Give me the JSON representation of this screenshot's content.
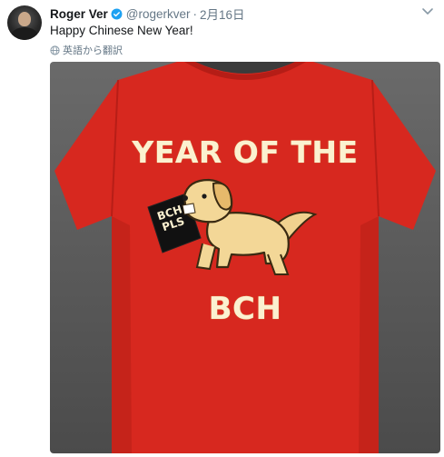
{
  "tweet": {
    "display_name": "Roger Ver",
    "handle": "@rogerkver",
    "separator": "·",
    "timestamp": "2月16日",
    "text": "Happy Chinese New Year!",
    "translate_label": "英語から翻訳"
  },
  "media": {
    "shirt_line1": "YEAR OF THE",
    "tag_line1": "BCH",
    "tag_line2": "PLS",
    "shirt_line2": "BCH"
  },
  "icons": {
    "verified": "verified-badge-icon",
    "caret": "chevron-down-icon",
    "translate": "globe-icon"
  },
  "colors": {
    "verified": "#1da1f2",
    "text_secondary": "#657786",
    "shirt_red": "#d7281f"
  }
}
